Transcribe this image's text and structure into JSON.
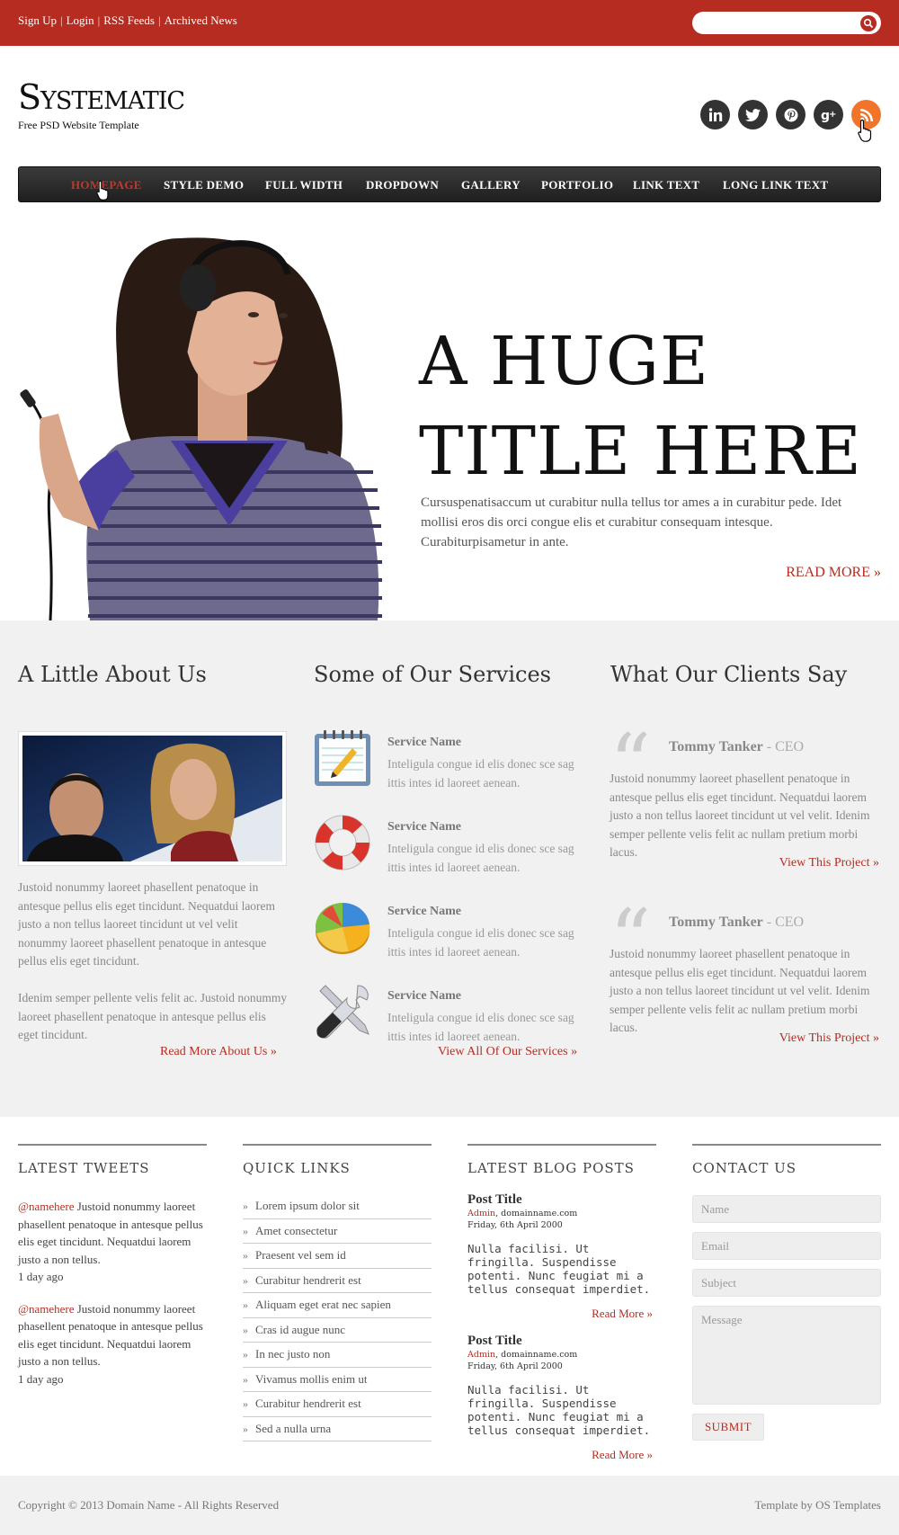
{
  "topbar": {
    "links": [
      "Sign Up",
      "Login",
      "RSS Feeds",
      "Archived News"
    ],
    "search_placeholder": ""
  },
  "header": {
    "logo": "Systematic",
    "tagline": "Free PSD Website Template",
    "social": [
      "linkedin-icon",
      "twitter-icon",
      "pinterest-icon",
      "googleplus-icon",
      "rss-icon"
    ]
  },
  "nav": {
    "items": [
      "HOMEPAGE",
      "STYLE DEMO",
      "FULL WIDTH",
      "DROPDOWN",
      "GALLERY",
      "PORTFOLIO",
      "LINK TEXT",
      "LONG LINK TEXT"
    ],
    "active_color": "#b72c21"
  },
  "hero": {
    "title_line1": "A HUGE",
    "title_line2": "TITLE HERE",
    "text": "Cursuspenatisaccum ut curabitur nulla tellus tor ames a in curabitur pede. Idet mollisi eros dis orci congue elis et curabitur consequam intesque. Curabiturpisametur in ante.",
    "more": "READ MORE »"
  },
  "about": {
    "heading": "A Little About Us",
    "para1": "Justoid nonummy laoreet phasellent penatoque in antesque pellus elis eget tincidunt. Nequatdui laorem justo a non tellus laoreet tincidunt ut vel velit nonummy laoreet phasellent penatoque in antesque pellus elis eget tincidunt.",
    "para2": "Idenim semper pellente velis felit ac. Justoid nonummy laoreet phasellent penatoque in antesque pellus elis eget tincidunt.",
    "more": "Read More About Us »"
  },
  "services": {
    "heading": "Some of Our Services",
    "items": [
      {
        "name": "Service Name",
        "desc": "Inteligula congue id elis donec sce sag ittis intes id laoreet aenean.",
        "icon": "notepad-icon"
      },
      {
        "name": "Service Name",
        "desc": "Inteligula congue id elis donec sce sag ittis intes id laoreet aenean.",
        "icon": "lifebuoy-icon"
      },
      {
        "name": "Service Name",
        "desc": "Inteligula congue id elis donec sce sag ittis intes id laoreet aenean.",
        "icon": "pie-chart-icon"
      },
      {
        "name": "Service Name",
        "desc": "Inteligula congue id elis donec sce sag ittis intes id laoreet aenean.",
        "icon": "tools-icon"
      }
    ],
    "more": "View All Of Our Services »"
  },
  "clients": {
    "heading": "What Our Clients Say",
    "items": [
      {
        "name": "Tommy Tanker",
        "role": " - CEO",
        "text": "Justoid nonummy laoreet phasellent penatoque in antesque pellus elis eget tincidunt. Nequatdui laorem justo a non tellus laoreet tincidunt ut vel velit. Idenim semper pellente velis felit ac nullam pretium morbi lacus.",
        "link": "View This Project »"
      },
      {
        "name": "Tommy Tanker",
        "role": " - CEO",
        "text": "Justoid nonummy laoreet phasellent penatoque in antesque pellus elis eget tincidunt. Nequatdui laorem justo a non tellus laoreet tincidunt ut vel velit. Idenim semper pellente velis felit ac nullam pretium morbi lacus.",
        "link": "View This Project »"
      }
    ]
  },
  "footer": {
    "tweets": {
      "heading": "LATEST TWEETS",
      "items": [
        {
          "handle": "@namehere",
          "text": " Justoid nonummy laoreet phasellent penatoque in antesque pellus elis eget tincidunt. Nequatdui laorem justo a non tellus.",
          "time": "1 day ago"
        },
        {
          "handle": "@namehere",
          "text": " Justoid nonummy laoreet phasellent penatoque in antesque pellus elis eget tincidunt. Nequatdui laorem justo a non tellus.",
          "time": "1 day ago"
        }
      ]
    },
    "quicklinks": {
      "heading": "QUICK LINKS",
      "items": [
        "Lorem ipsum dolor sit",
        "Amet consectetur",
        "Praesent vel sem id",
        "Curabitur hendrerit est",
        "Aliquam eget erat nec sapien",
        "Cras id augue nunc",
        "In nec justo non",
        "Vivamus mollis enim ut",
        "Curabitur hendrerit est",
        "Sed a nulla urna"
      ]
    },
    "blog": {
      "heading": "LATEST BLOG POSTS",
      "posts": [
        {
          "title": "Post Title",
          "author": "Admin",
          "domain": ", domainname.com",
          "date": "Friday, 6th April 2000",
          "excerpt": "Nulla facilisi. Ut fringilla. Suspendisse potenti. Nunc feugiat mi a tellus consequat imperdiet.",
          "more": "Read More »"
        },
        {
          "title": "Post Title",
          "author": "Admin",
          "domain": ", domainname.com",
          "date": "Friday, 6th April 2000",
          "excerpt": "Nulla facilisi. Ut fringilla. Suspendisse potenti. Nunc feugiat mi a tellus consequat imperdiet.",
          "more": "Read More »"
        }
      ]
    },
    "contact": {
      "heading": "CONTACT US",
      "name_placeholder": "Name",
      "email_placeholder": "Email",
      "subject_placeholder": "Subject",
      "message_placeholder": "Message",
      "submit": "SUBMIT"
    }
  },
  "bottom": {
    "copyright": "Copyright © 2013 Domain Name - All Rights Reserved",
    "credit": "Template by OS Templates"
  }
}
